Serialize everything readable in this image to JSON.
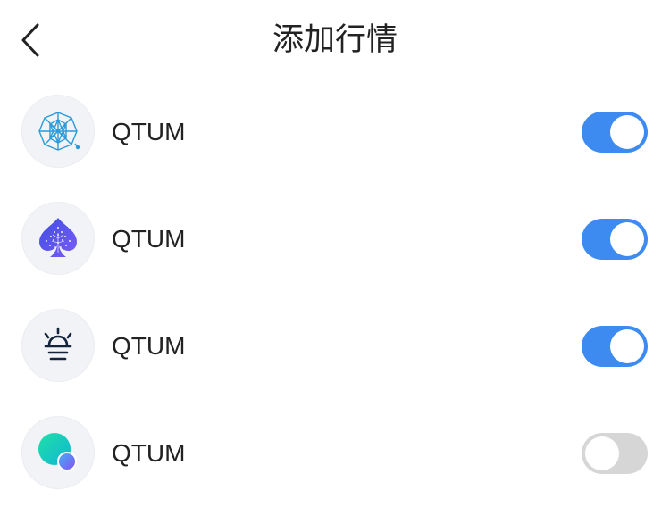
{
  "header": {
    "title": "添加行情",
    "back_icon": "chevron-left-icon"
  },
  "colors": {
    "toggle_on": "#3d8bf0",
    "toggle_off": "#d6d6d6"
  },
  "coins": [
    {
      "name": "QTUM",
      "icon": "qtum-network-icon",
      "enabled": true
    },
    {
      "name": "QTUM",
      "icon": "spade-icon",
      "enabled": true
    },
    {
      "name": "QTUM",
      "icon": "lamp-icon",
      "enabled": true
    },
    {
      "name": "QTUM",
      "icon": "gradient-circle-icon",
      "enabled": false
    }
  ]
}
